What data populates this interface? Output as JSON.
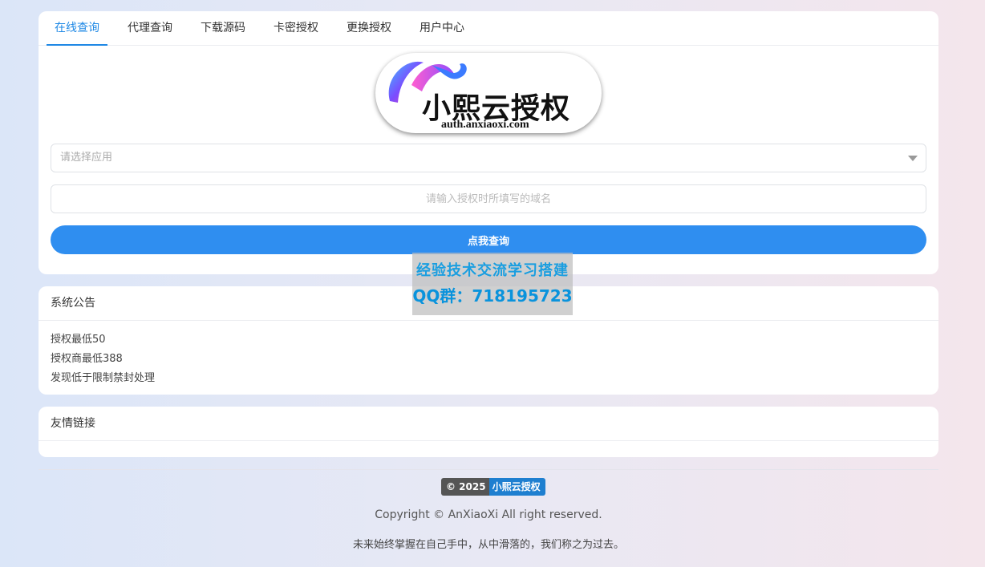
{
  "tabs": [
    {
      "label": "在线查询",
      "active": true
    },
    {
      "label": "代理查询"
    },
    {
      "label": "下载源码"
    },
    {
      "label": "卡密授权"
    },
    {
      "label": "更换授权"
    },
    {
      "label": "用户中心"
    }
  ],
  "logo": {
    "title": "小熙云授权",
    "subtitle": "auth.anxiaoxi.com"
  },
  "form": {
    "app_select_placeholder": "请选择应用",
    "domain_placeholder": "请输入授权时所填写的域名",
    "query_button": "点我查询"
  },
  "watermark": {
    "line1": "经验技术交流学习搭建",
    "line2": "QQ群：718195723"
  },
  "notice": {
    "title": "系统公告",
    "lines": [
      "授权最低50",
      "授权商最低388",
      "发现低于限制禁封处理"
    ]
  },
  "links": {
    "title": "友情链接"
  },
  "footer": {
    "badge_left": "© 2025",
    "badge_right": "小熙云授权",
    "copyright": "Copyright © AnXiaoXi All right reserved.",
    "motto": "未来始终掌握在自己手中，从中滑落的，我们称之为过去。"
  },
  "colors": {
    "accent": "#1e88e5",
    "button": "#2f8ef0",
    "watermark_text": "#1a9ee0"
  }
}
